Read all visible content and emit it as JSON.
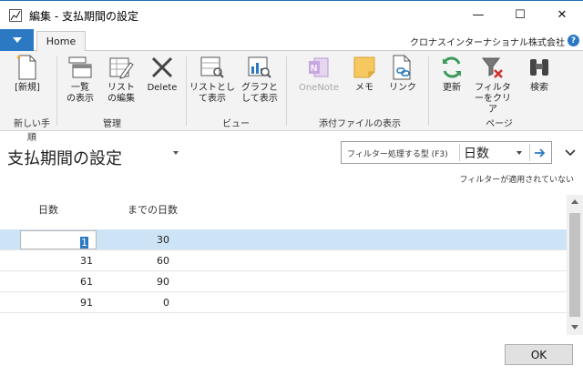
{
  "window": {
    "title": "編集 - 支払期間の設定",
    "minimize_glyph": "—",
    "maximize_glyph": "☐",
    "close_glyph": "✕"
  },
  "ribbon_tabs": {
    "home": "Home"
  },
  "company": "クロナスインターナショナル株式会社",
  "help_glyph": "?",
  "ribbon": {
    "new": "[新規]",
    "view_list_line1": "一覧",
    "view_list_line2": "の表示",
    "edit_list_line1": "リスト",
    "edit_list_line2": "の編集",
    "delete": "Delete",
    "show_as_list_line1": "リストとし",
    "show_as_list_line2": "て表示",
    "show_as_chart_line1": "グラフと",
    "show_as_chart_line2": "して表示",
    "onenote": "OneNote",
    "memo": "メモ",
    "link": "リンク",
    "refresh": "更新",
    "clear_filter_line1": "フィルタ",
    "clear_filter_line2": "ーをクリア",
    "find": "検索",
    "groups": {
      "new": "新しい手順",
      "manage": "管理",
      "view": "ビュー",
      "attachments": "添付ファイルの表示",
      "page": "ページ"
    }
  },
  "page": {
    "title": "支払期間の設定",
    "filter_placeholder": "フィルター処理する型 (F3)",
    "filter_field": "日数",
    "filter_status": "フィルターが適用されていない"
  },
  "columns": {
    "days": "日数",
    "until_days": "までの日数"
  },
  "rows": [
    {
      "days": "1",
      "until_days": "30"
    },
    {
      "days": "31",
      "until_days": "60"
    },
    {
      "days": "61",
      "until_days": "90"
    },
    {
      "days": "91",
      "until_days": "0"
    }
  ],
  "ok_button": "OK",
  "colors": {
    "accent": "#2b79c2",
    "selected_row": "#cde3f6",
    "ribbon_bg": "#f3f3f3"
  }
}
